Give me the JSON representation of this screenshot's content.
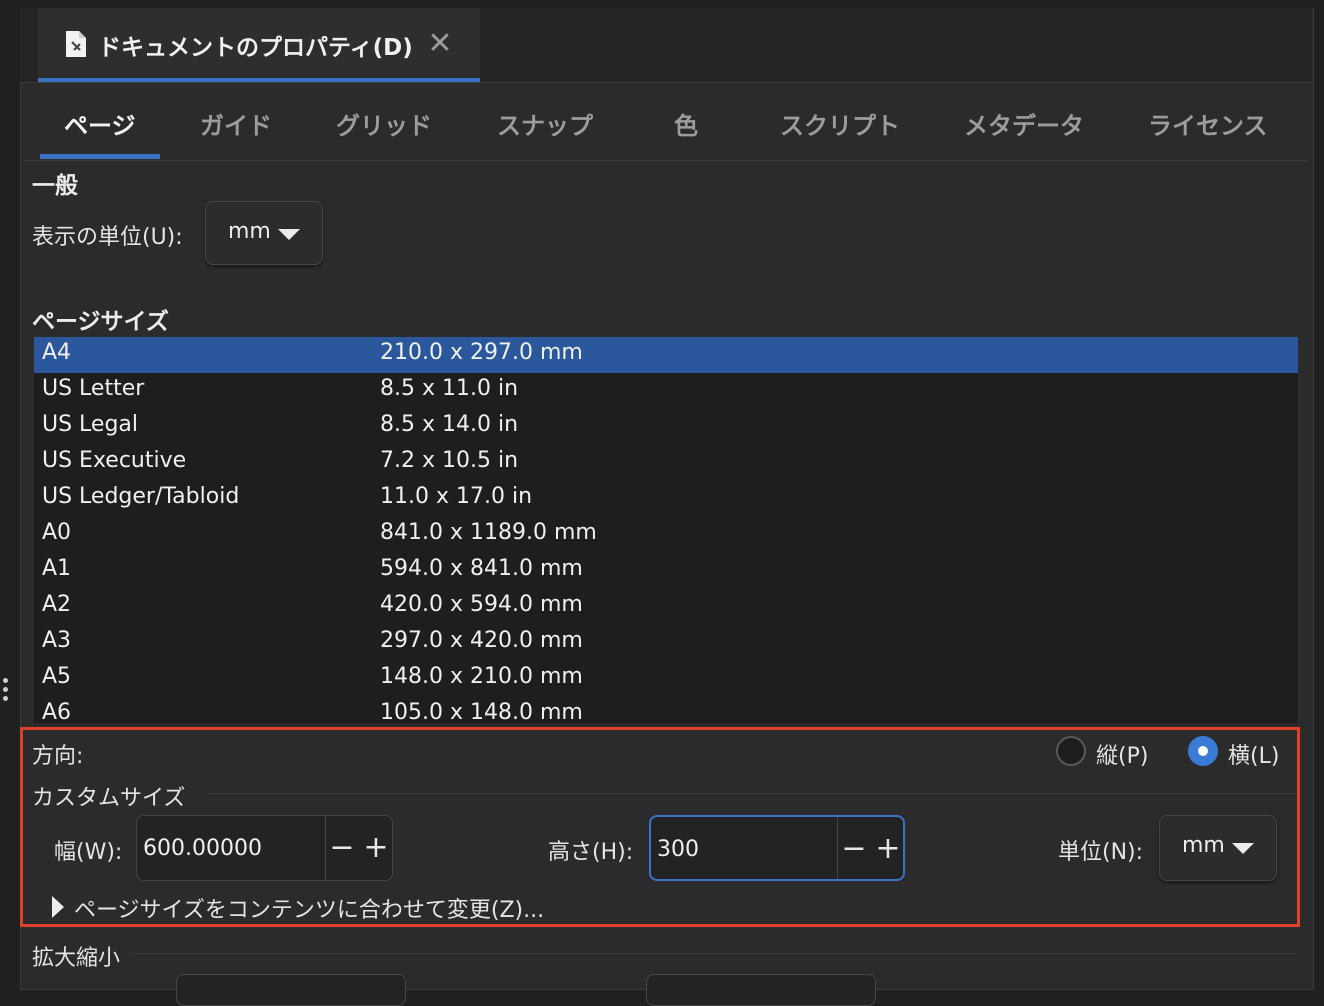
{
  "document_tab": {
    "title": "ドキュメントのプロパティ(D)",
    "close_glyph": "✕"
  },
  "tabs": [
    {
      "label": "ページ",
      "active": true
    },
    {
      "label": "ガイド"
    },
    {
      "label": "グリッド"
    },
    {
      "label": "スナップ"
    },
    {
      "label": "色"
    },
    {
      "label": "スクリプト"
    },
    {
      "label": "メタデータ"
    },
    {
      "label": "ライセンス"
    }
  ],
  "general": {
    "heading": "一般",
    "display_unit_label": "表示の単位(U):",
    "display_unit_value": "mm"
  },
  "page_size": {
    "heading": "ページサイズ",
    "selected_index": 0,
    "rows": [
      {
        "name": "A4",
        "dims": "210.0 x 297.0 mm"
      },
      {
        "name": "US Letter",
        "dims": "8.5 x 11.0 in"
      },
      {
        "name": "US Legal",
        "dims": "8.5 x 14.0 in"
      },
      {
        "name": "US Executive",
        "dims": "7.2 x 10.5 in"
      },
      {
        "name": "US Ledger/Tabloid",
        "dims": "11.0 x 17.0 in"
      },
      {
        "name": "A0",
        "dims": "841.0 x 1189.0 mm"
      },
      {
        "name": "A1",
        "dims": "594.0 x 841.0 mm"
      },
      {
        "name": "A2",
        "dims": "420.0 x 594.0 mm"
      },
      {
        "name": "A3",
        "dims": "297.0 x 420.0 mm"
      },
      {
        "name": "A5",
        "dims": "148.0 x 210.0 mm"
      },
      {
        "name": "A6",
        "dims": "105.0 x 148.0 mm"
      }
    ]
  },
  "orientation": {
    "label": "方向:",
    "portrait_label": "縦(P)",
    "landscape_label": "横(L)",
    "selected": "landscape"
  },
  "custom_size": {
    "heading": "カスタムサイズ",
    "width_label": "幅(W):",
    "width_value": "600.00000",
    "height_label": "高さ(H):",
    "height_value": "300",
    "unit_label": "単位(N):",
    "unit_value": "mm",
    "minus_glyph": "−",
    "plus_glyph": "+",
    "resize_to_content_label": "ページサイズをコンテンツに合わせて変更(Z)..."
  },
  "scale": {
    "heading": "拡大縮小"
  },
  "colors": {
    "accent": "#3a73c4",
    "selection": "#2b589c",
    "highlight_border": "#e0402a"
  }
}
